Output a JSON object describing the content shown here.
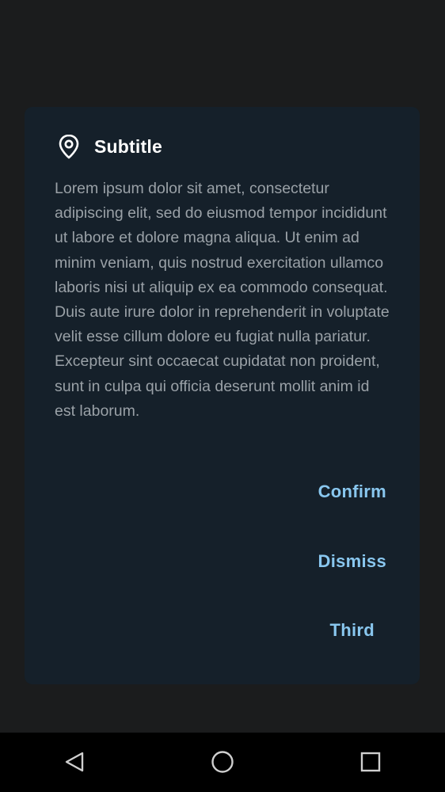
{
  "dialog": {
    "title": "Subtitle",
    "title_icon": "location-pin-icon",
    "body": "Lorem ipsum dolor sit amet, consectetur adipiscing elit, sed do eiusmod tempor incididunt ut labore et dolore magna aliqua. Ut enim ad minim veniam, quis nostrud exercitation ullamco laboris nisi ut aliquip ex ea commodo consequat. Duis aute irure dolor in reprehenderit in voluptate velit esse cillum dolore eu fugiat nulla pariatur. Excepteur sint occaecat cupidatat non proident, sunt in culpa qui officia deserunt mollit anim id est laborum.",
    "actions": {
      "confirm": "Confirm",
      "dismiss": "Dismiss",
      "third": "Third"
    }
  },
  "navbar": {
    "icons": [
      "back-triangle-icon",
      "home-circle-icon",
      "recents-square-icon"
    ]
  },
  "colors": {
    "background": "#1b1c1d",
    "dialog": "#15202a",
    "title": "#ffffff",
    "body_text": "#9aa1a7",
    "accent": "#89c7ef",
    "navbar": "#000000"
  }
}
